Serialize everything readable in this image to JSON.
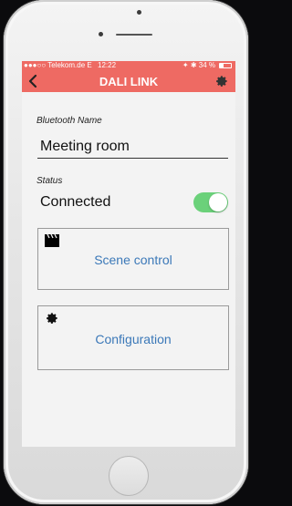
{
  "status_bar": {
    "carrier": "●●●○○ Telekom.de  E",
    "time": "12:22",
    "battery": "✦ ✱ 34 %",
    "battery_level": 0.34
  },
  "nav": {
    "title": "DALI LINK",
    "back_icon": "chevron-left-icon",
    "settings_icon": "gear-icon"
  },
  "bluetooth": {
    "label": "Bluetooth Name",
    "value": "Meeting room"
  },
  "status": {
    "label": "Status",
    "value": "Connected",
    "toggle_on": true,
    "toggle_color": "#6bd17a"
  },
  "cards": {
    "scene": {
      "label": "Scene control",
      "icon": "clapperboard-icon"
    },
    "config": {
      "label": "Configuration",
      "icon": "gear-icon"
    }
  },
  "colors": {
    "accent": "#ee6a63",
    "link": "#3b78b8"
  }
}
